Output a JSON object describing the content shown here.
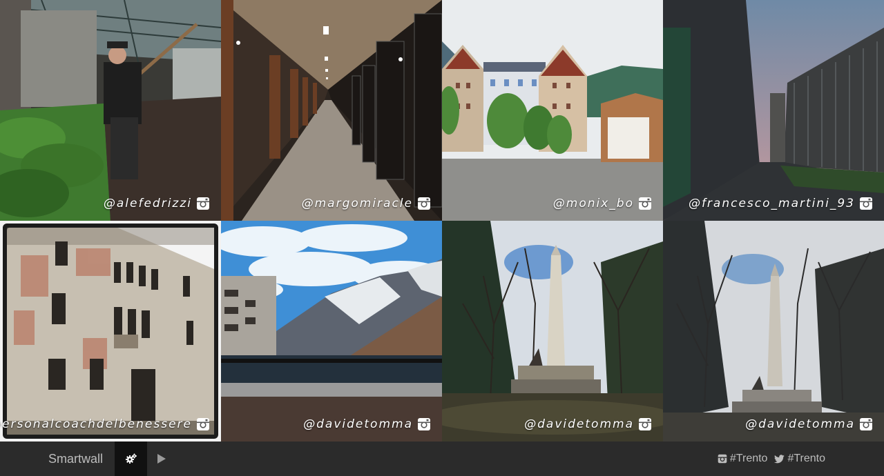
{
  "tiles": [
    {
      "handle": "@alefedrizzi",
      "icon": "instagram-icon"
    },
    {
      "handle": "@margomiracle",
      "icon": "instagram-icon"
    },
    {
      "handle": "@monix_bo",
      "icon": "instagram-icon"
    },
    {
      "handle": "@francesco_martini_93",
      "icon": "instagram-icon"
    },
    {
      "handle": "@personalcoachdelbenessere",
      "icon": "instagram-icon"
    },
    {
      "handle": "@davidetomma",
      "icon": "instagram-icon"
    },
    {
      "handle": "@davidetomma",
      "icon": "instagram-icon"
    },
    {
      "handle": "@davidetomma",
      "icon": "instagram-icon"
    }
  ],
  "footer": {
    "brand": "Smartwall",
    "settings_icon": "gears-icon",
    "play_icon": "play-icon",
    "tags": [
      {
        "icon": "instagram-icon",
        "label": "#Trento"
      },
      {
        "icon": "twitter-icon",
        "label": "#Trento"
      }
    ]
  },
  "colors": {
    "footer_bg": "#2b2b2b",
    "active_button_bg": "#111111",
    "footer_text": "#bdbdbd"
  }
}
